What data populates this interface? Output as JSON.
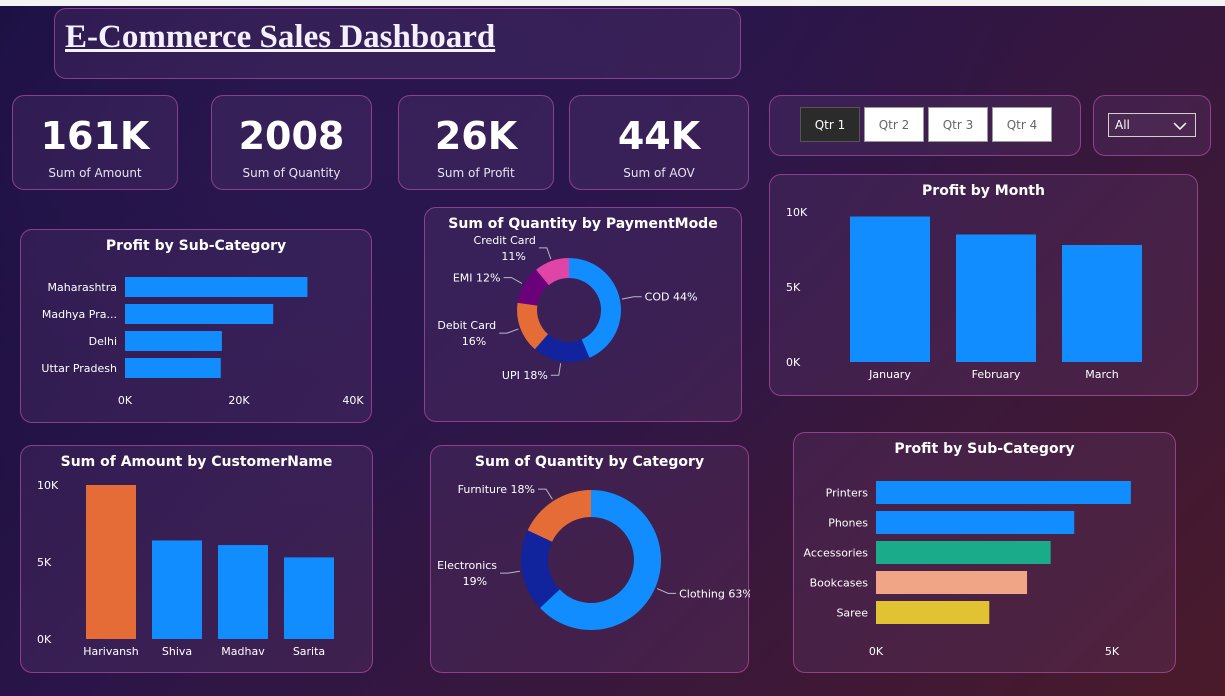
{
  "title": "E-Commerce Sales Dashboard",
  "kpis": [
    {
      "value": "161K",
      "label": "Sum of Amount"
    },
    {
      "value": "2008",
      "label": "Sum of Quantity"
    },
    {
      "value": "26K",
      "label": "Sum of Profit"
    },
    {
      "value": "44K",
      "label": "Sum of AOV"
    }
  ],
  "quarter_slicer": {
    "options": [
      "Qtr 1",
      "Qtr 2",
      "Qtr 3",
      "Qtr 4"
    ],
    "selected": "Qtr 1"
  },
  "state_dropdown": {
    "value": "All"
  },
  "colors": {
    "blue": "#118dff",
    "orange": "#e66c37",
    "navy": "#12239e",
    "purple": "#6b007b",
    "pink": "#e044a7",
    "teal": "#1aab8b",
    "salmon": "#f0a587",
    "yellow": "#e1c233"
  },
  "chart_data": [
    {
      "id": "profit_by_state",
      "type": "bar",
      "orientation": "horizontal",
      "title": "Profit by Sub-Category",
      "categories": [
        "Maharashtra",
        "Madhya Pra...",
        "Delhi",
        "Uttar Pradesh"
      ],
      "values": [
        32000,
        26000,
        17000,
        16800
      ],
      "xlim": [
        0,
        40000
      ],
      "ticks": [
        "0K",
        "20K",
        "40K"
      ]
    },
    {
      "id": "quantity_by_payment",
      "type": "pie",
      "donut": true,
      "title": "Sum of Quantity by PaymentMode",
      "labels": [
        "COD",
        "UPI",
        "Debit Card",
        "EMI",
        "Credit Card"
      ],
      "display_labels": [
        "COD 44%",
        "UPI 18%",
        "Debit Card|16%",
        "EMI 12%",
        "Credit Card|11%"
      ],
      "values": [
        44,
        18,
        16,
        12,
        11
      ],
      "colors": [
        "#118dff",
        "#12239e",
        "#e66c37",
        "#6b007b",
        "#e044a7"
      ]
    },
    {
      "id": "profit_by_month",
      "type": "bar",
      "title": "Profit by Month",
      "categories": [
        "January",
        "February",
        "March"
      ],
      "values": [
        9700,
        8500,
        7800
      ],
      "ylim": [
        0,
        10000
      ],
      "ticks": [
        "0K",
        "5K",
        "10K"
      ]
    },
    {
      "id": "amount_by_customer",
      "type": "bar",
      "title": "Sum of Amount by CustomerName",
      "categories": [
        "Harivansh",
        "Shiva",
        "Madhav",
        "Sarita"
      ],
      "values": [
        10000,
        6400,
        6100,
        5300
      ],
      "ylim": [
        0,
        10000
      ],
      "ticks": [
        "0K",
        "5K",
        "10K"
      ],
      "highlight": "Harivansh"
    },
    {
      "id": "quantity_by_category",
      "type": "pie",
      "donut": true,
      "title": "Sum of Quantity by Category",
      "labels": [
        "Clothing",
        "Electronics",
        "Furniture"
      ],
      "display_labels": [
        "Clothing 63%",
        "Electronics|19%",
        "Furniture 18%"
      ],
      "values": [
        63,
        19,
        18
      ],
      "colors": [
        "#118dff",
        "#12239e",
        "#e66c37"
      ]
    },
    {
      "id": "profit_by_subcategory",
      "type": "bar",
      "orientation": "horizontal",
      "title": "Profit by Sub-Category",
      "categories": [
        "Printers",
        "Phones",
        "Accessories",
        "Bookcases",
        "Saree"
      ],
      "values": [
        5400,
        4200,
        3700,
        3200,
        2400
      ],
      "xlim": [
        0,
        5000
      ],
      "ticks": [
        "0K",
        "5K"
      ],
      "colors": [
        "#118dff",
        "#118dff",
        "#1aab8b",
        "#f0a587",
        "#e1c233"
      ]
    }
  ]
}
